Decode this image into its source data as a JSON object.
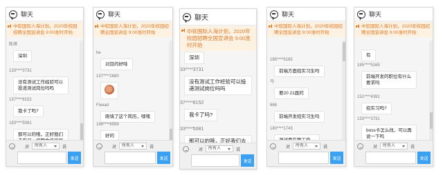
{
  "title": "聊天",
  "notice": "中软国际人海计划，2020年校园招聘全国宣讲会 9:00准时开始",
  "footer": {
    "to_label": "对",
    "audience": "所有人",
    "send": "发送",
    "trail": "说"
  },
  "panels": [
    {
      "messages": [
        {
          "user": "陈琪",
          "text": "深圳"
        },
        {
          "user": "133****3731",
          "text": "没有测试工作经验可以投递测试岗位吗吗"
        },
        {
          "user": "137****8152",
          "text": "我卡了吗?"
        },
        {
          "user": "183****5081",
          "text": "那可以的哦，正好我们去实习，招聘会信家可以电"
        }
      ]
    },
    {
      "messages": [
        {
          "user": "he",
          "text": "对目的好哇"
        },
        {
          "user": "137****2680",
          "text": ""
        },
        {
          "user": "Fixead",
          "text": "刚填了这个简历，嘿嘿"
        },
        {
          "user": "198****6599",
          "text": "好的"
        }
      ]
    },
    {
      "messages": [
        {
          "user": "",
          "text": "深圳"
        },
        {
          "user": "33****3731",
          "text": "没有测试工作经验可以投递测试岗位吗吗"
        },
        {
          "user": "37****8152",
          "text": "我卡了吗?"
        },
        {
          "user": "33****5081",
          "text": "那可以的哦，正好我们去实习，招聘会信家可以电话沟通吧"
        }
      ]
    },
    {
      "messages": [
        {
          "user": "185****5165",
          "text": "前端方面招实习生吗"
        },
        {
          "user": "马",
          "text": "要20 21届的"
        },
        {
          "user": "668",
          "text": "前端开发招实习生吗"
        },
        {
          "user": "180****1743",
          "text": "测试是在哪工作。"
        }
      ]
    },
    {
      "messages": [
        {
          "user": "",
          "text": "有"
        },
        {
          "user": "185****5165",
          "text": "前端开发的职位有什么要求吗"
        },
        {
          "user": "151****4391",
          "text": "招实习吗?"
        },
        {
          "user": "133****3731",
          "text": "boss卡怎么找，可以再说一下吗"
        }
      ]
    }
  ]
}
